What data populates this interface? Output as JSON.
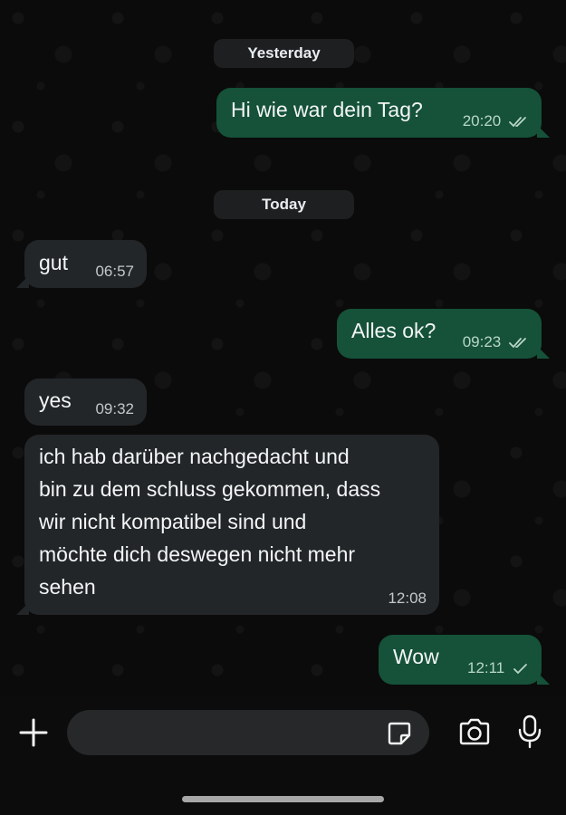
{
  "separators": {
    "yesterday": "Yesterday",
    "today": "Today"
  },
  "messages": [
    {
      "direction": "outgoing",
      "text": "Hi wie war dein Tag?",
      "time": "20:20",
      "status": "read"
    },
    {
      "direction": "incoming",
      "text": "gut",
      "time": "06:57"
    },
    {
      "direction": "outgoing",
      "text": "Alles ok?",
      "time": "09:23",
      "status": "read"
    },
    {
      "direction": "incoming",
      "text": "yes",
      "time": "09:32"
    },
    {
      "direction": "incoming",
      "text_lines": [
        "ich hab darüber nachgedacht und",
        "bin zu dem schluss gekommen, dass",
        "wir nicht kompatibel sind und",
        "möchte dich deswegen nicht mehr",
        "sehen"
      ],
      "time": "12:08"
    },
    {
      "direction": "outgoing",
      "text": "Wow",
      "time": "12:11",
      "status": "sent"
    }
  ],
  "composer": {
    "placeholder": ""
  },
  "icons": [
    "plus-icon",
    "sticker-icon",
    "camera-icon",
    "microphone-icon",
    "double-check-icon",
    "single-check-icon"
  ],
  "colors": {
    "outgoing_bubble": "#155239",
    "incoming_bubble": "#232628",
    "background": "#0b0b0b"
  }
}
